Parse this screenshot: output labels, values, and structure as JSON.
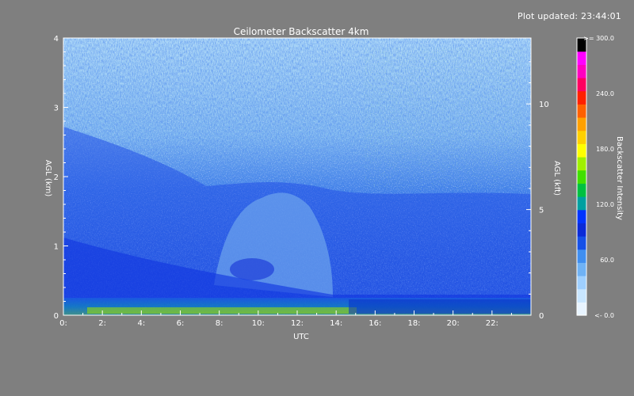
{
  "header": {
    "updated_label": "Plot updated: 23:44:01"
  },
  "chart_data": {
    "type": "heatmap",
    "title": "Ceilometer Backscatter 4km",
    "xlabel": "UTC",
    "ylabel": "AGL (km)",
    "y2label": "AGL (kft)",
    "xlim": [
      0,
      24
    ],
    "ylim": [
      0,
      4
    ],
    "y2lim": [
      0,
      13.12
    ],
    "x_ticks": [
      {
        "value": 0,
        "label": "0:"
      },
      {
        "value": 2,
        "label": "2:"
      },
      {
        "value": 4,
        "label": "4:"
      },
      {
        "value": 6,
        "label": "6:"
      },
      {
        "value": 8,
        "label": "8:"
      },
      {
        "value": 10,
        "label": "10:"
      },
      {
        "value": 12,
        "label": "12:"
      },
      {
        "value": 14,
        "label": "14:"
      },
      {
        "value": 16,
        "label": "16:"
      },
      {
        "value": 18,
        "label": "18:"
      },
      {
        "value": 20,
        "label": "20:"
      },
      {
        "value": 22,
        "label": "22:"
      }
    ],
    "y_ticks": [
      {
        "value": 0,
        "label": "0"
      },
      {
        "value": 1,
        "label": "1"
      },
      {
        "value": 2,
        "label": "2"
      },
      {
        "value": 3,
        "label": "3"
      },
      {
        "value": 4,
        "label": "4"
      }
    ],
    "y2_ticks": [
      {
        "value": 0,
        "label": "0"
      },
      {
        "value": 5,
        "label": "5"
      },
      {
        "value": 10,
        "label": "10"
      }
    ],
    "colorbar": {
      "label": "Backscatter Intensity",
      "range": [
        0,
        300
      ],
      "ticks": [
        {
          "value": 0,
          "label": "<-   0.0"
        },
        {
          "value": 60,
          "label": "60.0"
        },
        {
          "value": 120,
          "label": "120.0"
        },
        {
          "value": 180,
          "label": "180.0"
        },
        {
          "value": 240,
          "label": "240.0"
        },
        {
          "value": 300,
          "label": ">= 300.0"
        }
      ],
      "colors": [
        "#e8f4ff",
        "#c8e6ff",
        "#9ecfff",
        "#6fb2f5",
        "#3f8ef0",
        "#1550e8",
        "#0a2ad8",
        "#0033ff",
        "#00a0a0",
        "#00c040",
        "#40e000",
        "#a0f000",
        "#ffff00",
        "#ffd000",
        "#ffa000",
        "#ff6000",
        "#ff2000",
        "#ff0060",
        "#ff00c0",
        "#ff00ff",
        "#000000"
      ]
    },
    "features": {
      "surface_layer": {
        "height_km": 0.05
      },
      "boundary_layer": {
        "height_km": 0.4
      },
      "aerosol_dome": {
        "x_start": 8,
        "x_end": 14,
        "top_km": 1.8
      }
    }
  }
}
